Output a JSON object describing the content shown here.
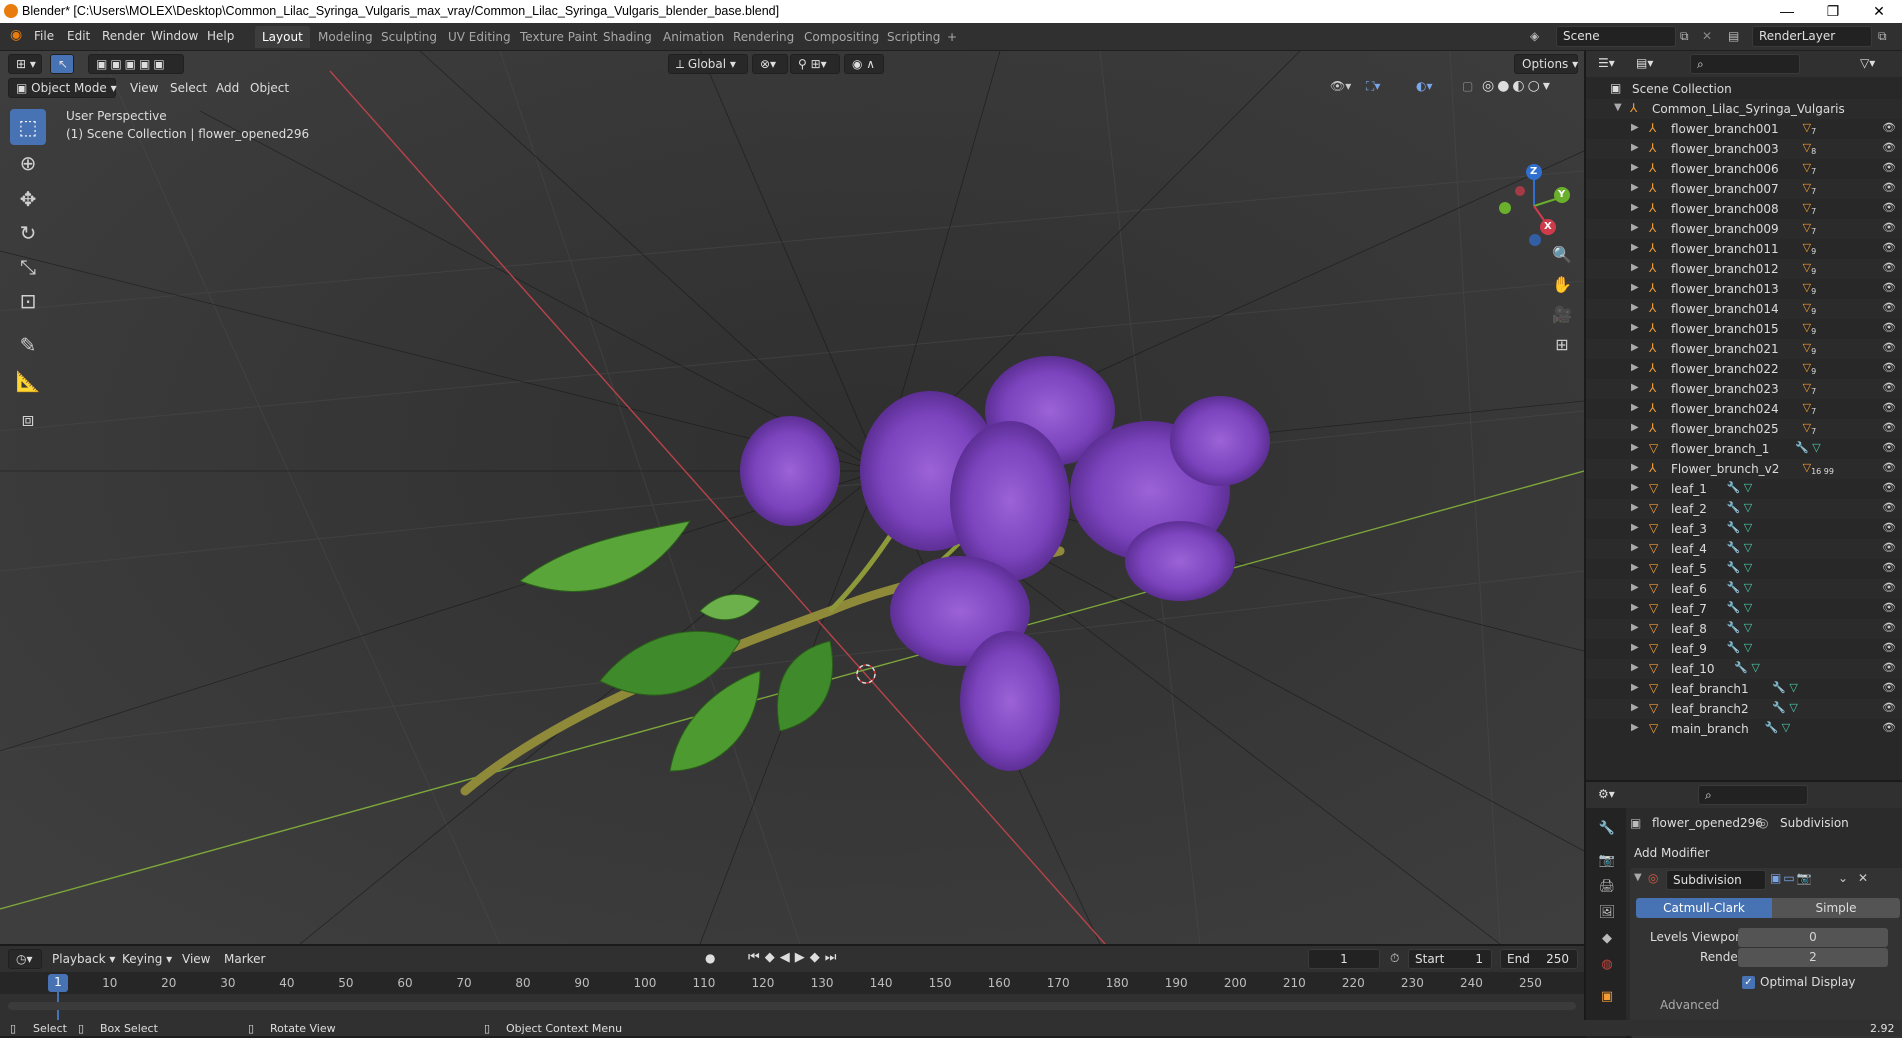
{
  "window": {
    "title": "Blender* [C:\\Users\\MOLEX\\Desktop\\Common_Lilac_Syringa_Vulgaris_max_vray/Common_Lilac_Syringa_Vulgaris_blender_base.blend]",
    "minimize": "—",
    "maximize": "❐",
    "close": "✕"
  },
  "menu": [
    "File",
    "Edit",
    "Render",
    "Window",
    "Help"
  ],
  "workspaces": [
    "Layout",
    "Modeling",
    "Sculpting",
    "UV Editing",
    "Texture Paint",
    "Shading",
    "Animation",
    "Rendering",
    "Compositing",
    "Scripting",
    "+"
  ],
  "scene": {
    "label": "Scene",
    "render_layer": "RenderLayer"
  },
  "viewport": {
    "mode": "Object Mode",
    "view": "View",
    "select": "Select",
    "add": "Add",
    "object": "Object",
    "transform": "Global",
    "options": "Options",
    "perspective": "User Perspective",
    "collection_info": "(1) Scene Collection | flower_opened296",
    "gizmo": {
      "x": "X",
      "y": "Y",
      "z": "Z"
    }
  },
  "outliner": {
    "root": "Scene Collection",
    "collection": "Common_Lilac_Syringa_Vulgaris",
    "items": [
      {
        "name": "flower_branch001",
        "kind": "empty",
        "badge": "7"
      },
      {
        "name": "flower_branch003",
        "kind": "empty",
        "badge": "8"
      },
      {
        "name": "flower_branch006",
        "kind": "empty",
        "badge": "7"
      },
      {
        "name": "flower_branch007",
        "kind": "empty",
        "badge": "7"
      },
      {
        "name": "flower_branch008",
        "kind": "empty",
        "badge": "7"
      },
      {
        "name": "flower_branch009",
        "kind": "empty",
        "badge": "7"
      },
      {
        "name": "flower_branch011",
        "kind": "empty",
        "badge": "9"
      },
      {
        "name": "flower_branch012",
        "kind": "empty",
        "badge": "9"
      },
      {
        "name": "flower_branch013",
        "kind": "empty",
        "badge": "9"
      },
      {
        "name": "flower_branch014",
        "kind": "empty",
        "badge": "9"
      },
      {
        "name": "flower_branch015",
        "kind": "empty",
        "badge": "9"
      },
      {
        "name": "flower_branch021",
        "kind": "empty",
        "badge": "9"
      },
      {
        "name": "flower_branch022",
        "kind": "empty",
        "badge": "9"
      },
      {
        "name": "flower_branch023",
        "kind": "empty",
        "badge": "7"
      },
      {
        "name": "flower_branch024",
        "kind": "empty",
        "badge": "7"
      },
      {
        "name": "flower_branch025",
        "kind": "empty",
        "badge": "7"
      },
      {
        "name": "flower_branch_1",
        "kind": "mesh",
        "badge": ""
      },
      {
        "name": "Flower_brunch_v2",
        "kind": "empty",
        "badge": "16 99"
      },
      {
        "name": "leaf_1",
        "kind": "mesh",
        "badge": ""
      },
      {
        "name": "leaf_2",
        "kind": "mesh",
        "badge": ""
      },
      {
        "name": "leaf_3",
        "kind": "mesh",
        "badge": ""
      },
      {
        "name": "leaf_4",
        "kind": "mesh",
        "badge": ""
      },
      {
        "name": "leaf_5",
        "kind": "mesh",
        "badge": ""
      },
      {
        "name": "leaf_6",
        "kind": "mesh",
        "badge": ""
      },
      {
        "name": "leaf_7",
        "kind": "mesh",
        "badge": ""
      },
      {
        "name": "leaf_8",
        "kind": "mesh",
        "badge": ""
      },
      {
        "name": "leaf_9",
        "kind": "mesh",
        "badge": ""
      },
      {
        "name": "leaf_10",
        "kind": "mesh",
        "badge": ""
      },
      {
        "name": "leaf_branch1",
        "kind": "mesh",
        "badge": ""
      },
      {
        "name": "leaf_branch2",
        "kind": "mesh",
        "badge": ""
      },
      {
        "name": "main_branch",
        "kind": "mesh",
        "badge": ""
      }
    ]
  },
  "properties": {
    "object": "flower_opened296",
    "modifier_tab": "Subdivision",
    "add_modifier": "Add Modifier",
    "modifier_name": "Subdivision",
    "catmull": "Catmull-Clark",
    "simple": "Simple",
    "levels_viewport_label": "Levels Viewport",
    "levels_viewport": "0",
    "render_label": "Render",
    "render": "2",
    "optimal_display": "Optimal Display",
    "advanced": "Advanced"
  },
  "timeline": {
    "playback": "Playback",
    "keying": "Keying",
    "view": "View",
    "marker": "Marker",
    "current_frame": "1",
    "start_label": "Start",
    "start": "1",
    "end_label": "End",
    "end": "250",
    "ticks": [
      "1",
      "10",
      "20",
      "30",
      "40",
      "50",
      "60",
      "70",
      "80",
      "90",
      "100",
      "110",
      "120",
      "130",
      "140",
      "150",
      "160",
      "170",
      "180",
      "190",
      "200",
      "210",
      "220",
      "230",
      "240",
      "250"
    ]
  },
  "status": {
    "select": "Select",
    "box_select": "Box Select",
    "rotate_view": "Rotate View",
    "context_menu": "Object Context Menu",
    "version": "2.92"
  }
}
